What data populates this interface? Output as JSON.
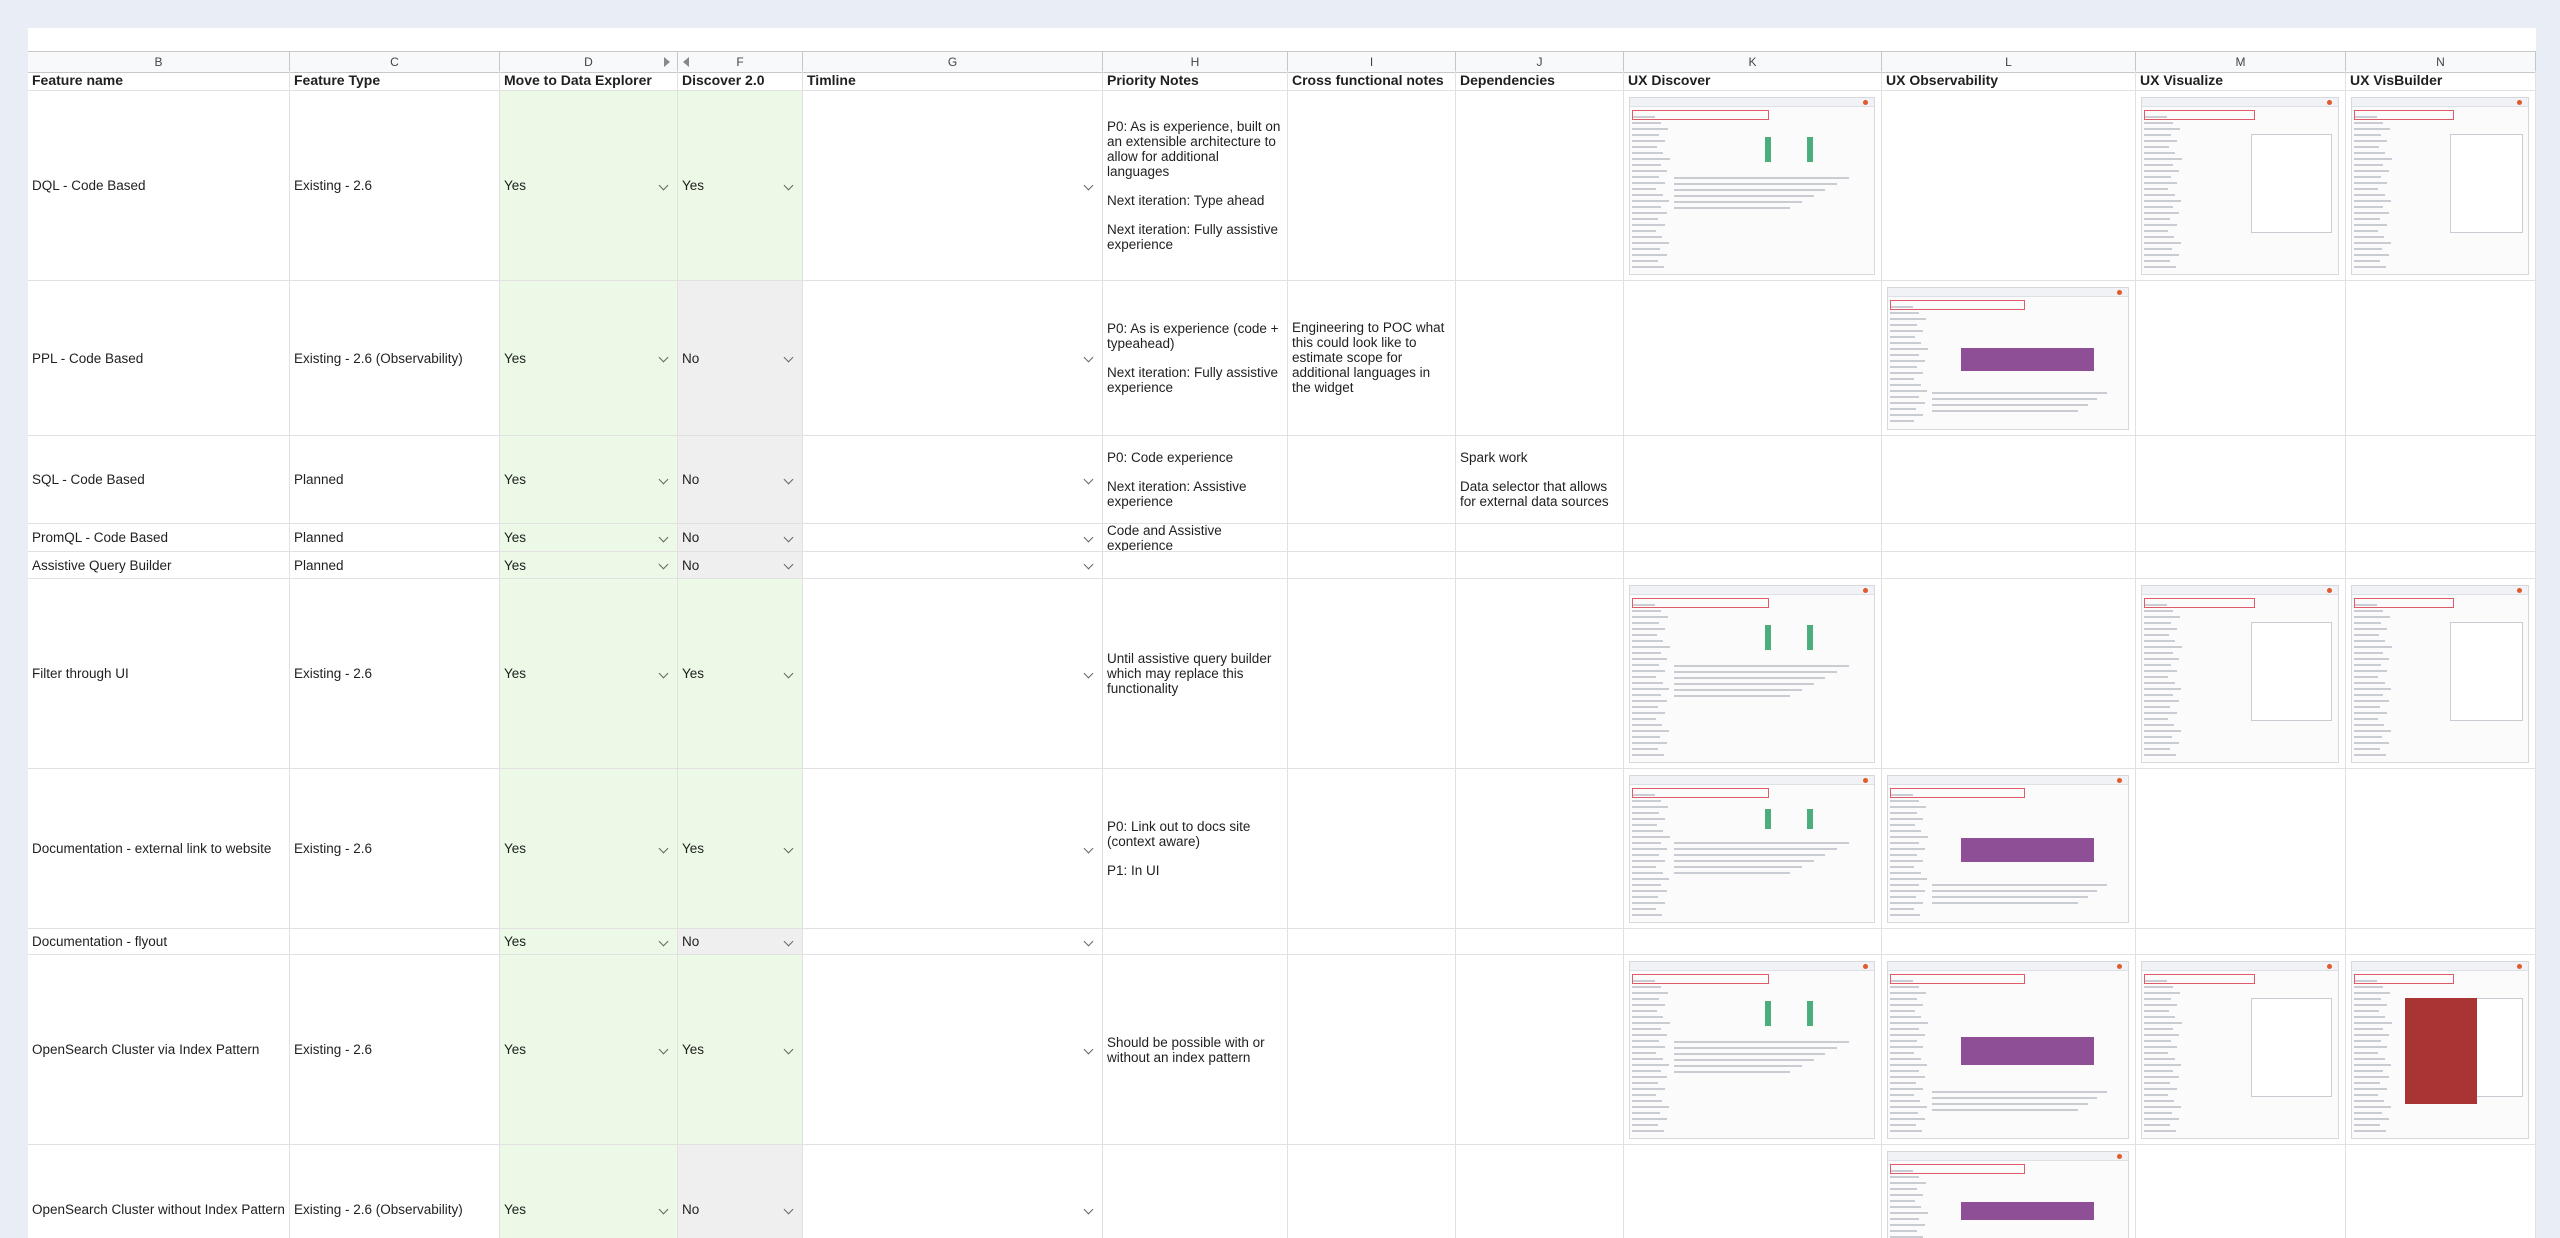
{
  "columns": [
    "B",
    "C",
    "D",
    "F",
    "G",
    "H",
    "I",
    "J",
    "K",
    "L",
    "M",
    "N"
  ],
  "headers": {
    "feature_name": "Feature name",
    "feature_type": "Feature Type",
    "move": "Move to Data Explorer",
    "discover": "Discover 2.0",
    "timeline": "Timline",
    "priority": "Priority Notes",
    "cross": "Cross functional notes",
    "deps": "Dependencies",
    "ux_discover": "UX Discover",
    "ux_obs": "UX Observability",
    "ux_vis": "UX Visualize",
    "ux_visb": "UX VisBuilder"
  },
  "rows": [
    {
      "name": "DQL - Code Based",
      "type": "Existing - 2.6",
      "move": "Yes",
      "discover": "Yes",
      "priority": [
        "P0: As is experience, built on an extensible architecture to allow for additional languages",
        "Next iteration: Type ahead",
        "Next iteration: Fully assistive experience"
      ],
      "cross": "",
      "deps": [
        "",
        ""
      ]
    },
    {
      "name": "PPL - Code Based",
      "type": "Existing - 2.6 (Observability)",
      "move": "Yes",
      "discover": "No",
      "priority": [
        "P0: As is experience (code + typeahead)",
        "Next iteration: Fully assistive experience"
      ],
      "cross": "Engineering to POC what this could look like to estimate scope for additional languages in the widget",
      "deps": [
        "",
        ""
      ]
    },
    {
      "name": "SQL - Code Based",
      "type": "Planned",
      "move": "Yes",
      "discover": "No",
      "priority": [
        "P0: Code experience",
        "Next iteration: Assistive experience"
      ],
      "cross": "",
      "deps": [
        "Spark work",
        "Data selector that allows for external data sources"
      ]
    },
    {
      "name": "PromQL - Code Based",
      "type": "Planned",
      "move": "Yes",
      "discover": "No",
      "priority": [
        "Code and Assistive experience"
      ],
      "cross": "",
      "deps": [
        "",
        ""
      ]
    },
    {
      "name": "Assistive Query Builder",
      "type": "Planned",
      "move": "Yes",
      "discover": "No",
      "priority": [
        ""
      ],
      "cross": "",
      "deps": [
        "",
        ""
      ]
    },
    {
      "name": "Filter through UI",
      "type": "Existing - 2.6",
      "move": "Yes",
      "discover": "Yes",
      "priority": [
        "Until assistive query builder which may replace this functionality"
      ],
      "cross": "",
      "deps": [
        "",
        ""
      ]
    },
    {
      "name": "Documentation - external link to website",
      "type": "Existing - 2.6",
      "move": "Yes",
      "discover": "Yes",
      "priority": [
        "P0: Link out to docs site (context aware)",
        "P1: In UI"
      ],
      "cross": "",
      "deps": [
        "",
        ""
      ]
    },
    {
      "name": "Documentation - flyout",
      "type": "",
      "move": "Yes",
      "discover": "No",
      "priority": [
        ""
      ],
      "cross": "",
      "deps": [
        "",
        ""
      ]
    },
    {
      "name": "OpenSearch Cluster via Index Pattern",
      "type": "Existing - 2.6",
      "move": "Yes",
      "discover": "Yes",
      "priority": [
        "Should be possible with or without an index pattern"
      ],
      "cross": "",
      "deps": [
        "",
        ""
      ]
    },
    {
      "name": "OpenSearch Cluster without Index Pattern",
      "type": "Existing - 2.6 (Observability)",
      "move": "Yes",
      "discover": "No",
      "priority": [
        ""
      ],
      "cross": "",
      "deps": [
        "",
        ""
      ]
    }
  ]
}
